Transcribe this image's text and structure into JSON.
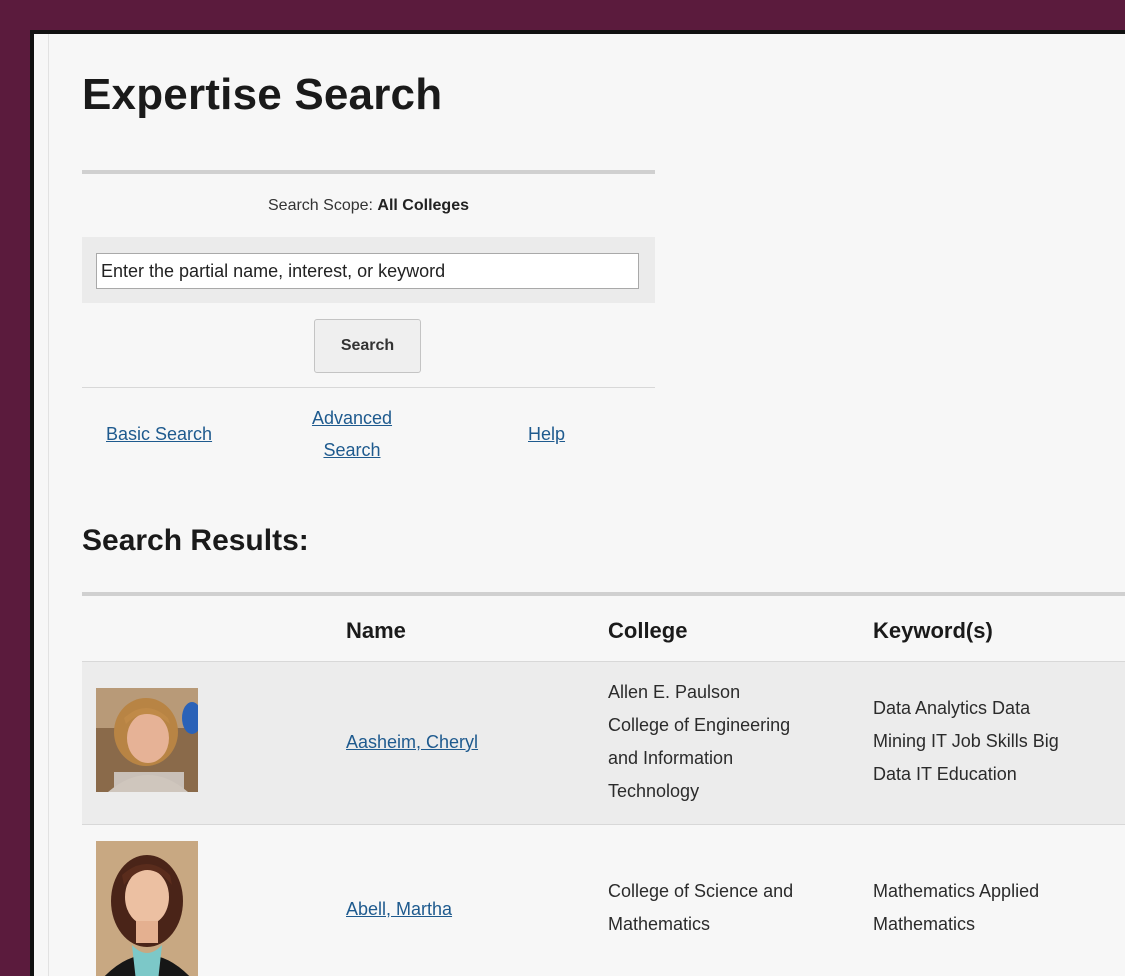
{
  "page": {
    "title": "Expertise Search"
  },
  "search": {
    "scope_label": "Search Scope:",
    "scope_value": "All Colleges",
    "input_value": "Enter the partial name, interest, or keyword",
    "button_label": "Search"
  },
  "links": {
    "basic": "Basic Search",
    "advanced_line1": "Advanced",
    "advanced_line2": "Search",
    "help": "Help"
  },
  "results": {
    "title": "Search Results:",
    "columns": [
      "Name",
      "College",
      "Keyword(s)"
    ],
    "rows": [
      {
        "name": "Aasheim, Cheryl",
        "college_lines": [
          "Allen E. Paulson",
          "College of Engineering",
          "and Information",
          "Technology"
        ],
        "keyword_lines": [
          "Data Analytics Data",
          "Mining IT Job Skills Big",
          "Data IT Education"
        ]
      },
      {
        "name": "Abell, Martha",
        "college_lines": [
          "College of Science and",
          "Mathematics"
        ],
        "keyword_lines": [
          "Mathematics Applied",
          "Mathematics"
        ]
      }
    ]
  },
  "colors": {
    "frame": "#5b1b3d",
    "link": "#1e5a8e",
    "panel": "#f7f7f7"
  }
}
